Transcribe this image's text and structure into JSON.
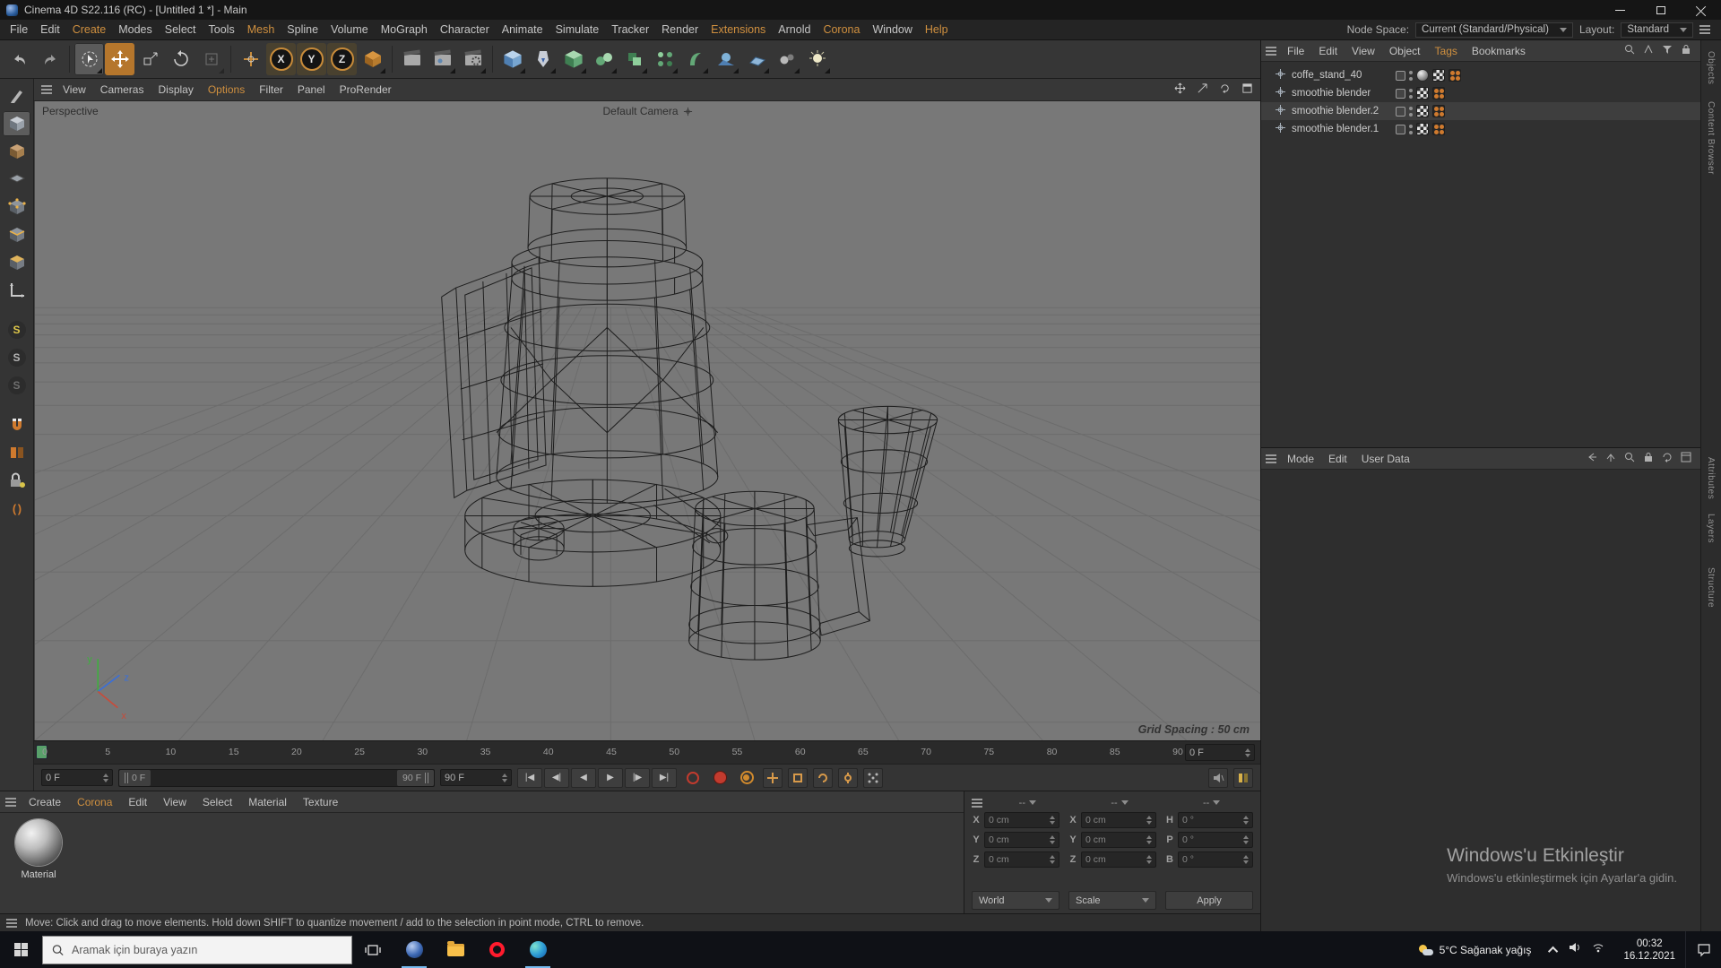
{
  "window": {
    "title": "Cinema 4D S22.116 (RC) - [Untitled 1 *] - Main"
  },
  "menubar": {
    "items": [
      "File",
      "Edit",
      "Create",
      "Modes",
      "Select",
      "Tools",
      "Mesh",
      "Spline",
      "Volume",
      "MoGraph",
      "Character",
      "Animate",
      "Simulate",
      "Tracker",
      "Render",
      "Extensions",
      "Arnold",
      "Corona",
      "Window",
      "Help"
    ],
    "node_space_label": "Node Space:",
    "node_space_value": "Current (Standard/Physical)",
    "layout_label": "Layout:",
    "layout_value": "Standard"
  },
  "toolbar": {
    "axis_x": "X",
    "axis_y": "Y",
    "axis_z": "Z",
    "icons": [
      "undo",
      "redo",
      "live-selection",
      "move",
      "scale",
      "rotate",
      "last-tool",
      "global-move",
      "x-lock",
      "y-lock",
      "z-lock",
      "coordinate-system",
      "render-view",
      "render-picture-viewer",
      "edit-render-settings",
      "add-cube",
      "add-spline",
      "add-subdivision-surface",
      "add-symmetry",
      "add-instance",
      "add-array",
      "add-deformer",
      "add-environment",
      "add-floor",
      "add-stage",
      "add-light"
    ]
  },
  "palette": {
    "snap_glyph": "S",
    "brackets_glyph": "( )",
    "icons": [
      "make-editable",
      "model-mode",
      "texture-mode",
      "workplane-mode",
      "points-mode",
      "edges-mode",
      "polygons-mode",
      "enable-axis",
      "snap-enable",
      "snap-modes",
      "snap-settings",
      "magnet",
      "mirror",
      "lock-workplane",
      "scripting"
    ]
  },
  "viewport": {
    "menus": [
      "View",
      "Cameras",
      "Display",
      "Options",
      "Filter",
      "Panel",
      "ProRender"
    ],
    "view_label": "Perspective",
    "camera_label": "Default Camera",
    "grid_label": "Grid Spacing : 50 cm",
    "axis_x": "x",
    "axis_y": "y",
    "axis_z": "z"
  },
  "timeline": {
    "ticks": [
      "0",
      "5",
      "10",
      "15",
      "20",
      "25",
      "30",
      "35",
      "40",
      "45",
      "50",
      "55",
      "60",
      "65",
      "70",
      "75",
      "80",
      "85",
      "90"
    ],
    "ruler_frame": "0 F"
  },
  "animation": {
    "current_frame": "0 F",
    "range_start": "0 F",
    "range_end": "90 F",
    "end_frame": "90 F",
    "transport": [
      "|◀",
      "◀|",
      "◀",
      "▶",
      "|▶",
      "▶|"
    ],
    "buttons": [
      "record-ring",
      "record",
      "autokey",
      "key-position",
      "key-scale",
      "key-rotation",
      "key-parameter",
      "key-pla",
      "sound",
      "timeline-layout"
    ]
  },
  "materials": {
    "menus": [
      "Create",
      "Corona",
      "Edit",
      "View",
      "Select",
      "Material",
      "Texture"
    ],
    "items": [
      {
        "name": "Material"
      }
    ]
  },
  "coordinates": {
    "headers": [
      "--",
      "--",
      "--"
    ],
    "position": {
      "labels": [
        "X",
        "Y",
        "Z"
      ],
      "values": [
        "0 cm",
        "0 cm",
        "0 cm"
      ]
    },
    "size": {
      "labels": [
        "X",
        "Y",
        "Z"
      ],
      "values": [
        "0 cm",
        "0 cm",
        "0 cm"
      ]
    },
    "rotation": {
      "labels": [
        "H",
        "P",
        "B"
      ],
      "values": [
        "0 °",
        "0 °",
        "0 °"
      ]
    },
    "space_select": "World",
    "scale_select": "Scale",
    "apply_label": "Apply"
  },
  "object_manager": {
    "menus": [
      "File",
      "Edit",
      "View",
      "Object",
      "Tags",
      "Bookmarks"
    ],
    "objects": [
      {
        "name": "coffe_stand_40"
      },
      {
        "name": "smoothie blender"
      },
      {
        "name": "smoothie blender.2"
      },
      {
        "name": "smoothie blender.1"
      }
    ]
  },
  "attribute_manager": {
    "menus": [
      "Mode",
      "Edit",
      "User Data"
    ]
  },
  "side_tabs": [
    "Objects",
    "Content Browser",
    "Attributes",
    "Layers",
    "Structure"
  ],
  "statusbar": {
    "text": "Move: Click and drag to move elements. Hold down SHIFT to quantize movement / add to the selection in point mode, CTRL to remove."
  },
  "watermark": {
    "line1": "Windows'u Etkinleştir",
    "line2": "Windows'u etkinleştirmek için Ayarlar'a gidin."
  },
  "taskbar": {
    "search_placeholder": "Aramak için buraya yazın",
    "weather": "5°C Sağanak yağış",
    "time": "00:32",
    "date": "16.12.2021"
  },
  "colors": {
    "accent": "#c98c3a",
    "viewport_bg": "#787878",
    "record_red": "#c23b2e",
    "key_orange": "#d18a2d",
    "marker_green": "#58a06a"
  }
}
